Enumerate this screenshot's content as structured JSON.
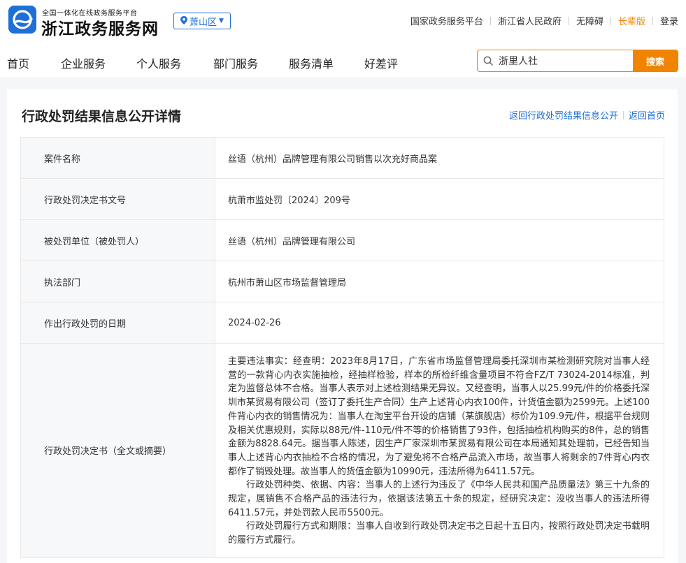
{
  "header": {
    "site_subtitle": "全国一体化在线政务服务平台",
    "site_name": "浙江政务服务网",
    "region": "萧山区",
    "top_links": [
      "国家政务服务平台",
      "浙江省人民政府",
      "无障碍",
      "长辈版",
      "登录"
    ],
    "accent_color": "#f08300",
    "brand_color": "#1e6fd9"
  },
  "nav": {
    "items": [
      "首页",
      "企业服务",
      "个人服务",
      "部门服务",
      "服务清单",
      "好差评"
    ]
  },
  "search": {
    "value": "浙里人社",
    "button": "搜索"
  },
  "card": {
    "title": "行政处罚结果信息公开详情",
    "links": [
      "返回行政处罚结果信息公开",
      "返回首页"
    ]
  },
  "rows": [
    {
      "key": "案件名称",
      "value": "丝语（杭州）品牌管理有限公司销售以次充好商品案"
    },
    {
      "key": "行政处罚决定书文号",
      "value": "杭萧市监处罚〔2024〕209号"
    },
    {
      "key": "被处罚单位（被处罚人）",
      "value": "丝语（杭州）品牌管理有限公司"
    },
    {
      "key": "执法部门",
      "value": "杭州市萧山区市场监督管理局"
    },
    {
      "key": "作出行政处罚的日期",
      "value": "2024-02-26"
    },
    {
      "key": "行政处罚决定书（全文或摘要）",
      "paragraphs": [
        "主要违法事实：经查明：2023年8月17日，广东省市场监督管理局委托深圳市某检测研究院对当事人经营的一款背心内衣实施抽检，经抽样检验，样本的所检纤维含量项目不符合FZ/T 73024-2014标准，判定为监督总体不合格。当事人表示对上述检测结果无异议。又经查明，当事人以25.99元/件的价格委托深圳市某贸易有限公司（签订了委托生产合同）生产上述背心内衣100件，计货值金额为2599元。上述100件背心内衣的销售情况为：当事人在淘宝平台开设的店铺（某旗舰店）标价为109.9元/件，根据平台规则及相关优惠规则，实际以88元/件-110元/件不等的价格销售了93件，包括抽检机构购买的8件，总的销售金额为8828.64元。据当事人陈述，因生产厂家深圳市某贸易有限公司在本局通知其处理前，已经告知当事人上述背心内衣抽检不合格的情况，为了避免将不合格产品流入市场，故当事人将剩余的7件背心内衣都作了销毁处理。故当事人的货值金额为10990元，违法所得为6411.57元。",
        "行政处罚种类、依据、内容：当事人的上述行为违反了《中华人民共和国产品质量法》第三十九条的规定，属销售不合格产品的违法行为，依据该法第五十条的规定，经研究决定：没收当事人的违法所得6411.57元，并处罚款人民币5500元。",
        "行政处罚履行方式和期限：当事人自收到行政处罚决定书之日起十五日内，按照行政处罚决定书载明的履行方式履行。"
      ]
    }
  ]
}
